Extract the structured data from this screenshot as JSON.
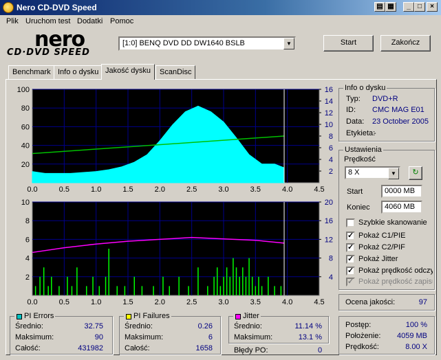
{
  "window": {
    "title": "Nero CD-DVD Speed"
  },
  "menu": [
    "Plik",
    "Uruchom test",
    "Dodatki",
    "Pomoc"
  ],
  "logo": {
    "main": "nero",
    "sub": "CD·DVD SPEED"
  },
  "drive": {
    "selected": "[1:0]  BENQ DVD DD DW1640 BSLB"
  },
  "buttons": {
    "start": "Start",
    "stop": "Zakończ"
  },
  "tabs": [
    "Benchmark",
    "Info o dysku",
    "Jakość dysku",
    "ScanDisc"
  ],
  "disc_info": {
    "title": "Info o dysku",
    "rows": [
      {
        "label": "Typ:",
        "value": "DVD+R"
      },
      {
        "label": "ID:",
        "value": "CMC MAG E01"
      },
      {
        "label": "Data:",
        "value": "23 October 2005"
      },
      {
        "label": "Etykieta:",
        "value": "-"
      }
    ]
  },
  "settings": {
    "title": "Ustawienia",
    "speed_label": "Prędkość",
    "speed_value": "8 X",
    "start_label": "Start",
    "start_value": "0000 MB",
    "end_label": "Koniec",
    "end_value": "4060 MB",
    "checks": [
      {
        "label": "Szybkie skanowanie",
        "checked": false,
        "disabled": false
      },
      {
        "label": "Pokaż C1/PIE",
        "checked": true,
        "disabled": false
      },
      {
        "label": "Pokaż C2/PIF",
        "checked": true,
        "disabled": false
      },
      {
        "label": "Pokaż Jitter",
        "checked": true,
        "disabled": false
      },
      {
        "label": "Pokaż prędkość odczytu",
        "checked": true,
        "disabled": false
      },
      {
        "label": "Pokaż prędkość zapisu",
        "checked": true,
        "disabled": true
      }
    ]
  },
  "quality": {
    "label": "Ocena jakości:",
    "value": "97"
  },
  "pi_errors": {
    "title": "PI Errors",
    "color": "#00c0c0",
    "rows": [
      {
        "label": "Średnio:",
        "value": "32.75"
      },
      {
        "label": "Maksimum:",
        "value": "90"
      },
      {
        "label": "Całość:",
        "value": "431982"
      }
    ]
  },
  "pi_failures": {
    "title": "PI Failures",
    "color": "#ffff00",
    "rows": [
      {
        "label": "Średnio:",
        "value": "0.26"
      },
      {
        "label": "Maksimum:",
        "value": "6"
      },
      {
        "label": "Całość:",
        "value": "1658"
      }
    ]
  },
  "jitter": {
    "title": "Jitter",
    "color": "#ff00ff",
    "rows": [
      {
        "label": "Średnio:",
        "value": "11.14 %"
      },
      {
        "label": "Maksimum:",
        "value": "13.1 %"
      }
    ],
    "po_label": "Błędy PO:",
    "po_value": "0"
  },
  "progress": {
    "rows": [
      {
        "label": "Postęp:",
        "value": "100 %"
      },
      {
        "label": "Położenie:",
        "value": "4059 MB"
      },
      {
        "label": "Prędkość:",
        "value": "8.00 X"
      }
    ]
  },
  "chart_data": [
    {
      "type": "area",
      "series": [
        {
          "kind": "area",
          "color": "#00ffff",
          "x": [
            0.0,
            0.2,
            0.4,
            0.6,
            0.8,
            1.0,
            1.2,
            1.4,
            1.6,
            1.8,
            2.0,
            2.2,
            2.4,
            2.6,
            2.8,
            3.0,
            3.2,
            3.4,
            3.6,
            3.8,
            3.95
          ],
          "y": [
            12,
            10,
            10,
            10,
            11,
            12,
            14,
            17,
            22,
            30,
            45,
            62,
            76,
            82,
            76,
            65,
            48,
            30,
            20,
            20,
            16
          ]
        },
        {
          "kind": "line",
          "color": "#00c000",
          "x": [
            0.0,
            3.95
          ],
          "y": [
            5.0,
            8.0
          ]
        }
      ],
      "x_ticks": [
        "0.0",
        "0.5",
        "1.0",
        "1.5",
        "2.0",
        "2.5",
        "3.0",
        "3.5",
        "4.0",
        "4.5"
      ],
      "y_left_ticks": [
        "100",
        "80",
        "60",
        "40",
        "20"
      ],
      "y_right_ticks": [
        "16",
        "14",
        "12",
        "10",
        "8",
        "6",
        "4",
        "2"
      ],
      "xlim": [
        0,
        4.5
      ],
      "ylim": [
        0,
        100
      ],
      "y_right_lim": [
        0,
        16
      ],
      "grid": true
    },
    {
      "type": "bar",
      "series": [
        {
          "kind": "bars",
          "color": "#00ff00",
          "x": [
            0.05,
            0.12,
            0.18,
            0.25,
            0.3,
            0.42,
            0.55,
            0.62,
            0.7,
            0.85,
            0.95,
            1.05,
            1.15,
            1.2,
            1.33,
            1.45,
            1.6,
            1.72,
            1.9,
            2.05,
            2.15,
            2.3,
            2.45,
            2.6,
            2.75,
            2.85,
            2.9,
            2.95,
            3.0,
            3.05,
            3.1,
            3.15,
            3.2,
            3.25,
            3.3,
            3.35,
            3.4,
            3.45,
            3.5,
            3.55,
            3.6,
            3.7,
            3.8,
            3.9
          ],
          "y": [
            1,
            2,
            3,
            1,
            2,
            1,
            2,
            1,
            3,
            1,
            2,
            1,
            2,
            5,
            1,
            1,
            2,
            1,
            1,
            2,
            1,
            2,
            1,
            3,
            1,
            2,
            3,
            1,
            2,
            3,
            2,
            4,
            3,
            2,
            3,
            2,
            4,
            2,
            1,
            2,
            1,
            2,
            1,
            1
          ]
        },
        {
          "kind": "line",
          "color": "#ff00ff",
          "x": [
            0.0,
            0.5,
            1.0,
            1.5,
            2.0,
            2.5,
            3.0,
            3.5,
            3.95
          ],
          "y": [
            9.2,
            10.2,
            11.0,
            11.6,
            12.0,
            12.4,
            12.1,
            11.8,
            11.2
          ]
        }
      ],
      "x_ticks": [
        "0.0",
        "0.5",
        "1.0",
        "1.5",
        "2.0",
        "2.5",
        "3.0",
        "3.5",
        "4.0",
        "4.5"
      ],
      "y_left_ticks": [
        "10",
        "8",
        "6",
        "4",
        "2"
      ],
      "y_right_ticks": [
        "20",
        "16",
        "12",
        "8",
        "4"
      ],
      "xlim": [
        0,
        4.5
      ],
      "ylim": [
        0,
        10
      ],
      "y_right_lim": [
        0,
        20
      ],
      "grid": true
    }
  ]
}
